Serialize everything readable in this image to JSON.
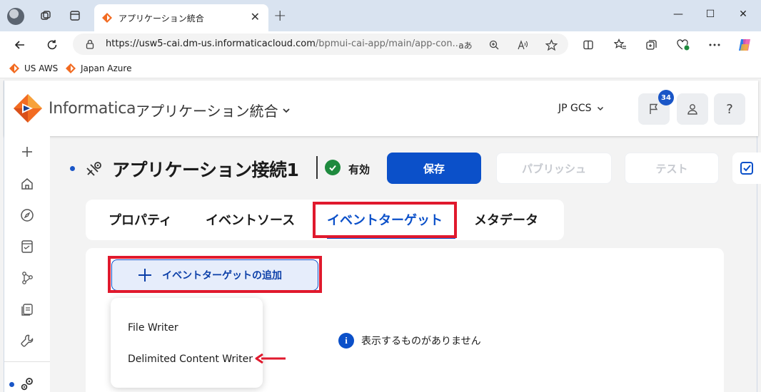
{
  "browser": {
    "tab_title": "アプリケーション統合",
    "url_main": "https://usw5-cai.dm-us.informaticacloud.com",
    "url_path": "/bpmui-cai-app/main/app-con...",
    "read_aloud": "aあ",
    "bookmarks": [
      {
        "label": "US AWS"
      },
      {
        "label": "Japan Azure"
      }
    ]
  },
  "header": {
    "brand": "Informatica",
    "app_name": "アプリケーション統合",
    "org": "JP GCS",
    "notification_count": "34",
    "help": "?"
  },
  "page": {
    "title": "アプリケーション接続1",
    "status": "有効",
    "save_label": "保存",
    "publish_label": "パブリッシュ",
    "test_label": "テスト"
  },
  "tabs": [
    {
      "label": "プロパティ"
    },
    {
      "label": "イベントソース"
    },
    {
      "label": "イベントターゲット"
    },
    {
      "label": "メタデータ"
    }
  ],
  "content": {
    "add_label": "イベントターゲットの追加",
    "empty_message": "表示するものがありません",
    "menu_items": [
      {
        "label": "File Writer"
      },
      {
        "label": "Delimited Content Writer"
      }
    ]
  },
  "colors": {
    "primary": "#0b50c9",
    "highlight": "#e0192d",
    "status_ok": "#1e8a3e"
  }
}
